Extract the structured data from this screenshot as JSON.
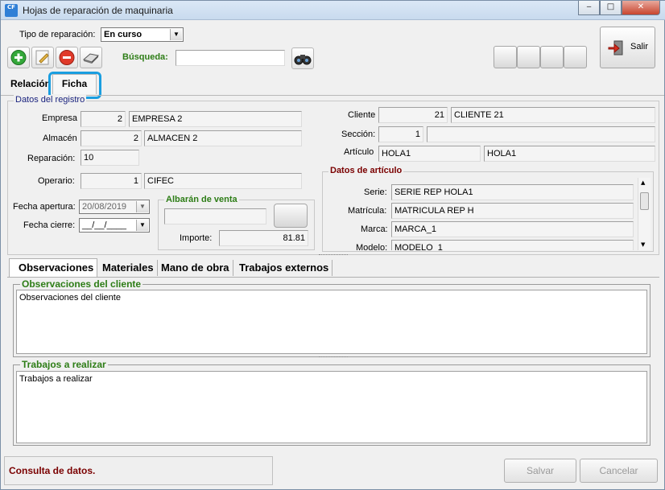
{
  "window": {
    "title": "Hojas de reparación de maquinaria",
    "app_icon_text": "CF"
  },
  "toolbar": {
    "tipo_label": "Tipo de reparación:",
    "tipo_value": "En curso",
    "busqueda_label": "Búsqueda:",
    "busqueda_value": "",
    "salir_label": "Salir"
  },
  "tabs": {
    "relacion": "Relación",
    "ficha": "Ficha"
  },
  "datos_registro": {
    "title": "Datos del registro",
    "empresa_label": "Empresa",
    "empresa_code": "2",
    "empresa_name": "EMPRESA 2",
    "almacen_label": "Almacén",
    "almacen_code": "2",
    "almacen_name": "ALMACEN 2",
    "reparacion_label": "Reparación:",
    "reparacion_value": "10",
    "operario_label": "Operario:",
    "operario_code": "1",
    "operario_name": "CIFEC",
    "fecha_apertura_label": "Fecha apertura:",
    "fecha_apertura_value": "20/08/2019",
    "fecha_cierre_label": "Fecha cierre:",
    "fecha_cierre_value": "__/__/____",
    "cliente_label": "Cliente",
    "cliente_code": "21",
    "cliente_name": "CLIENTE 21",
    "seccion_label": "Sección:",
    "seccion_code": "1",
    "seccion_name": "",
    "articulo_label": "Artículo",
    "articulo_code": "HOLA1",
    "articulo_name": "HOLA1"
  },
  "albaran": {
    "title": "Albarán de venta",
    "importe_label": "Importe:",
    "importe_value": "81.81"
  },
  "datos_articulo": {
    "title": "Datos de artículo",
    "serie_label": "Serie:",
    "serie_value": "SERIE REP HOLA1",
    "matricula_label": "Matrícula:",
    "matricula_value": "MATRICULA REP H",
    "marca_label": "Marca:",
    "marca_value": "MARCA_1",
    "modelo_label": "Modelo:",
    "modelo_value": "MODELO_1"
  },
  "subtabs": {
    "observaciones": "Observaciones",
    "materiales": "Materiales",
    "mano_obra": "Mano de obra",
    "trabajos_externos": "Trabajos externos"
  },
  "observaciones": {
    "cliente_title": "Observaciones del cliente",
    "cliente_text": "Observaciones del cliente",
    "trabajos_title": "Trabajos a realizar",
    "trabajos_text": "Trabajos a realizar"
  },
  "footer": {
    "status": "Consulta de datos.",
    "guardar": "Salvar",
    "cancelar": "Cancelar"
  },
  "colors": {
    "green_title": "#2d7d16",
    "dark_red_title": "#7a0000",
    "highlight_ring": "#1a9ee0"
  }
}
